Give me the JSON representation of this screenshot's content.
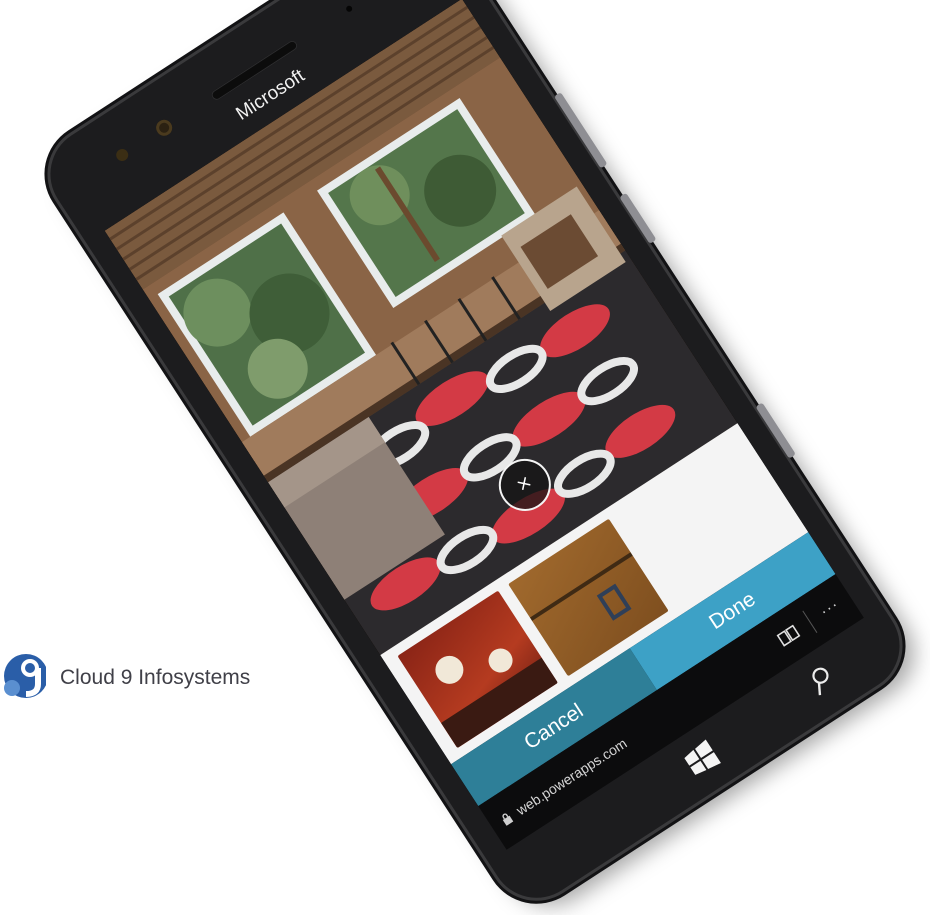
{
  "device": {
    "brand": "Microsoft"
  },
  "camera": {
    "capture_icon": "close-icon",
    "capture_glyph": "×"
  },
  "actions": {
    "cancel_label": "Cancel",
    "done_label": "Done"
  },
  "browser": {
    "url": "web.powerapps.com",
    "lock_icon": "lock-icon",
    "reading_icon": "reading-view-icon",
    "more_icon": "more-icon",
    "more_glyph": "···"
  },
  "navigation": {
    "windows_icon": "windows-icon",
    "search_icon": "search-icon"
  },
  "company": {
    "name": "Cloud 9 Infosystems"
  },
  "colors": {
    "cancel_button": "#2e7f98",
    "done_button": "#3da1c6",
    "phone_body": "#1c1c1e"
  }
}
